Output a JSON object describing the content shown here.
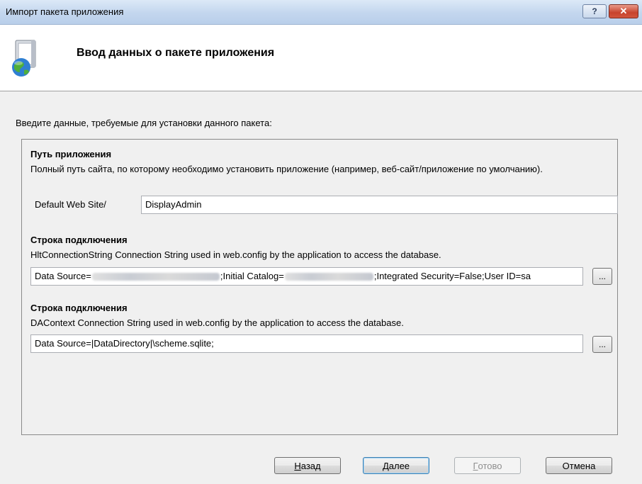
{
  "window": {
    "title": "Импорт пакета приложения",
    "help_glyph": "?",
    "close_glyph": "✕"
  },
  "header": {
    "title": "Ввод данных о пакете приложения",
    "icon": "package-globe-icon"
  },
  "intro_text": "Введите данные, требуемые для установки данного пакета:",
  "sections": [
    {
      "title": "Путь приложения",
      "description": "Полный путь сайта, по которому необходимо установить приложение (например, веб-сайт/приложение по умолчанию).",
      "prefix": "Default Web Site/",
      "value": "DisplayAdmin"
    },
    {
      "title": "Строка подключения",
      "description": "HltConnectionString Connection String used in web.config by the application to access the database.",
      "value_part1": "Data Source=",
      "value_part2": ";Initial Catalog=",
      "value_part3": ";Integrated Security=False;User ID=sa",
      "browse_label": "..."
    },
    {
      "title": "Строка подключения",
      "description": "DAContext Connection String used in web.config by the application to access the database.",
      "value": "Data Source=|DataDirectory|\\scheme.sqlite;",
      "browse_label": "..."
    }
  ],
  "buttons": {
    "back": {
      "accel": "Н",
      "rest": "азад"
    },
    "next": {
      "accel": "Д",
      "rest": "алее"
    },
    "finish": {
      "accel": "Г",
      "rest": "отово"
    },
    "cancel": "Отмена"
  },
  "colors": {
    "titlebar": "#c3d6ee",
    "close_button": "#c7432d",
    "default_button_border": "#3c7fb1"
  }
}
